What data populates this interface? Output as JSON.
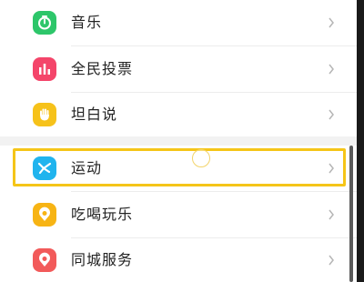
{
  "menu": {
    "items": [
      {
        "label": "音乐",
        "icon": "music-icon",
        "color": "#2dc66a"
      },
      {
        "label": "全民投票",
        "icon": "vote-chart-icon",
        "color": "#f4456a"
      },
      {
        "label": "坦白说",
        "icon": "hand-icon",
        "color": "#f6c21a"
      },
      {
        "label": "运动",
        "icon": "running-icon",
        "color": "#20b4ee"
      },
      {
        "label": "吃喝玩乐",
        "icon": "food-pin-icon",
        "color": "#f7b414"
      },
      {
        "label": "同城服务",
        "icon": "city-pin-icon",
        "color": "#f25a5a"
      }
    ]
  },
  "highlight_color": "#f5c518"
}
